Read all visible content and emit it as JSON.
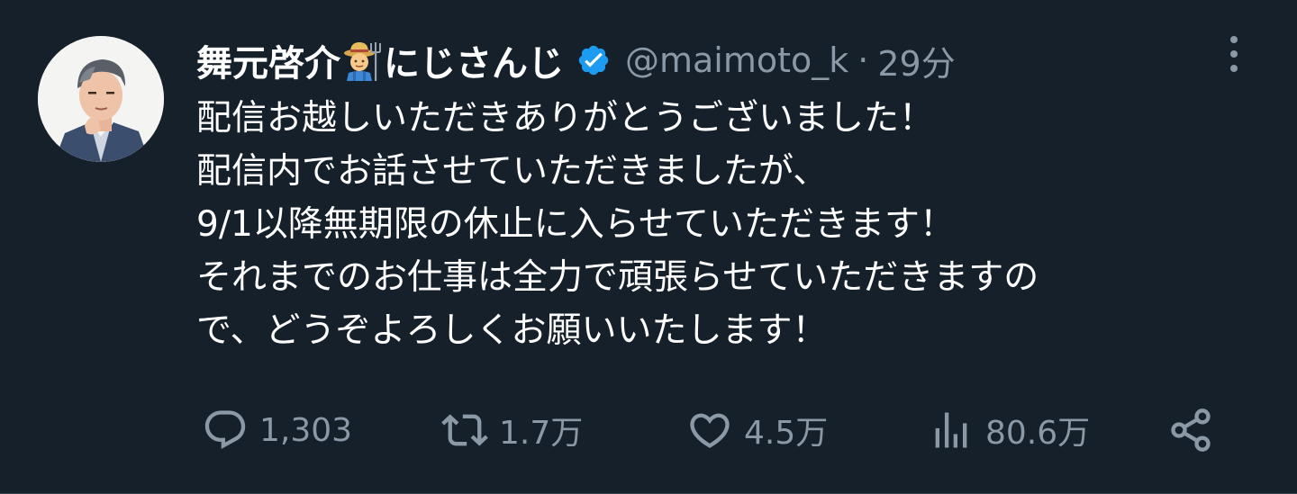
{
  "tweet": {
    "author": {
      "name": "舞元啓介",
      "name_suffix": "にじさんじ",
      "emoji": "farmer-emoji",
      "verified": true,
      "handle": "@maimoto_k",
      "separator": "·",
      "time": "29分"
    },
    "text_lines": [
      "配信お越しいただきありがとうございました！",
      "配信内でお話させていただきましたが、",
      "9/1以降無期限の休止に入らせていただきます！",
      "それまでのお仕事は全力で頑張らせていただきますの",
      "で、どうぞよろしくお願いいたします！"
    ],
    "actions": {
      "replies": "1,303",
      "retweets": "1.7万",
      "likes": "4.5万",
      "views": "80.6万"
    }
  },
  "colors": {
    "background": "#15202b",
    "text": "#ffffff",
    "secondary": "#8b98a5",
    "verified": "#1d9bf0"
  },
  "icons": [
    "more-icon",
    "verified-icon",
    "reply-icon",
    "retweet-icon",
    "like-icon",
    "views-icon",
    "share-icon"
  ]
}
